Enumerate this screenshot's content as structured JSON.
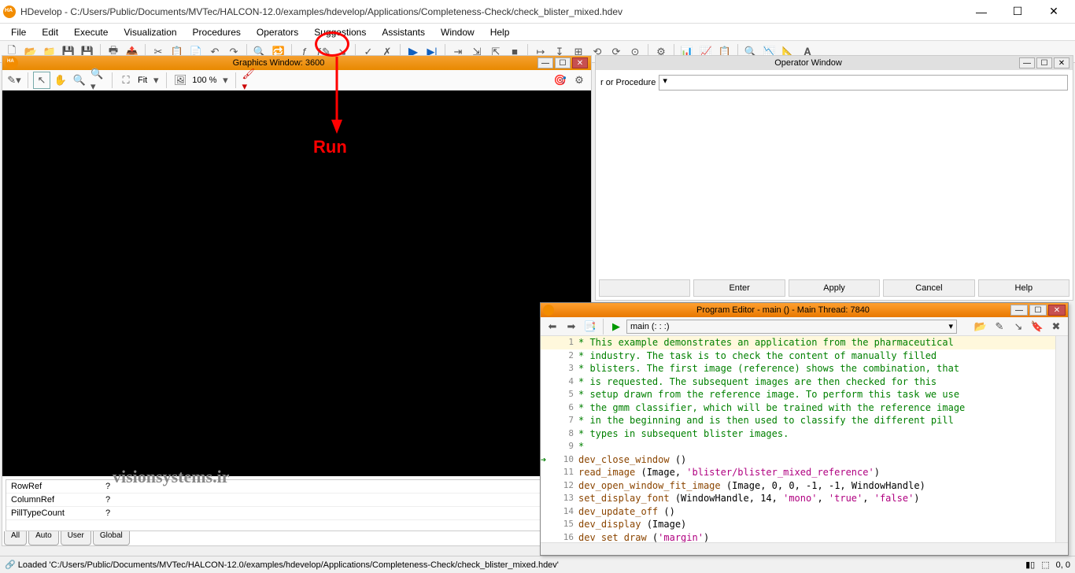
{
  "titlebar": {
    "title": "HDevelop - C:/Users/Public/Documents/MVTec/HALCON-12.0/examples/hdevelop/Applications/Completeness-Check/check_blister_mixed.hdev"
  },
  "menu": [
    "File",
    "Edit",
    "Execute",
    "Visualization",
    "Procedures",
    "Operators",
    "Suggestions",
    "Assistants",
    "Window",
    "Help"
  ],
  "annotation": {
    "run_label": "Run"
  },
  "graphics": {
    "title": "Graphics Window: 3600",
    "fit_label": "Fit",
    "zoom_label": "100 %",
    "vars": [
      {
        "name": "RowRef",
        "val": "?"
      },
      {
        "name": "ColumnRef",
        "val": "?"
      },
      {
        "name": "PillTypeCount",
        "val": "?"
      }
    ],
    "tabs": [
      "All",
      "Auto",
      "User",
      "Global"
    ]
  },
  "watermark": "visionsystems.ir",
  "operator": {
    "title": "Operator Window",
    "combo_label": "r or Procedure",
    "buttons": [
      "",
      "Enter",
      "Apply",
      "Cancel",
      "Help"
    ]
  },
  "program": {
    "title": "Program Editor - main () - Main Thread: 7840",
    "combo": "main (: : :)",
    "code": [
      {
        "n": 1,
        "t": "comment",
        "text": "* This example demonstrates an application from the pharmaceutical",
        "hl": true
      },
      {
        "n": 2,
        "t": "comment",
        "text": "* industry. The task is to check the content of manually filled"
      },
      {
        "n": 3,
        "t": "comment",
        "text": "* blisters. The first image (reference) shows the combination, that"
      },
      {
        "n": 4,
        "t": "comment",
        "text": "* is requested. The subsequent images are then checked for this"
      },
      {
        "n": 5,
        "t": "comment",
        "text": "* setup drawn from the reference image. To perform this task we use"
      },
      {
        "n": 6,
        "t": "comment",
        "text": "* the gmm classifier, which will be trained with the reference image"
      },
      {
        "n": 7,
        "t": "comment",
        "text": "* in the beginning and is then used to classify the different pill"
      },
      {
        "n": 8,
        "t": "comment",
        "text": "* types in subsequent blister images."
      },
      {
        "n": 9,
        "t": "comment",
        "text": "* "
      },
      {
        "n": 10,
        "t": "proc",
        "proc": "dev_close_window",
        "args": " ()",
        "cur": true
      },
      {
        "n": 11,
        "t": "proc",
        "proc": "read_image",
        "args": " (Image, 'blister/blister_mixed_reference')"
      },
      {
        "n": 12,
        "t": "proc",
        "proc": "dev_open_window_fit_image",
        "args": " (Image, 0, 0, -1, -1, WindowHandle)"
      },
      {
        "n": 13,
        "t": "proc",
        "proc": "set_display_font",
        "args": " (WindowHandle, 14, 'mono', 'true', 'false')"
      },
      {
        "n": 14,
        "t": "proc",
        "proc": "dev_update_off",
        "args": " ()"
      },
      {
        "n": 15,
        "t": "proc",
        "proc": "dev_display",
        "args": " (Image)"
      },
      {
        "n": 16,
        "t": "proc",
        "proc": "dev_set_draw",
        "args": " ('margin')"
      }
    ]
  },
  "statusbar": {
    "msg": "Loaded 'C:/Users/Public/Documents/MVTec/HALCON-12.0/examples/hdevelop/Applications/Completeness-Check/check_blister_mixed.hdev'",
    "coord": "0, 0"
  }
}
